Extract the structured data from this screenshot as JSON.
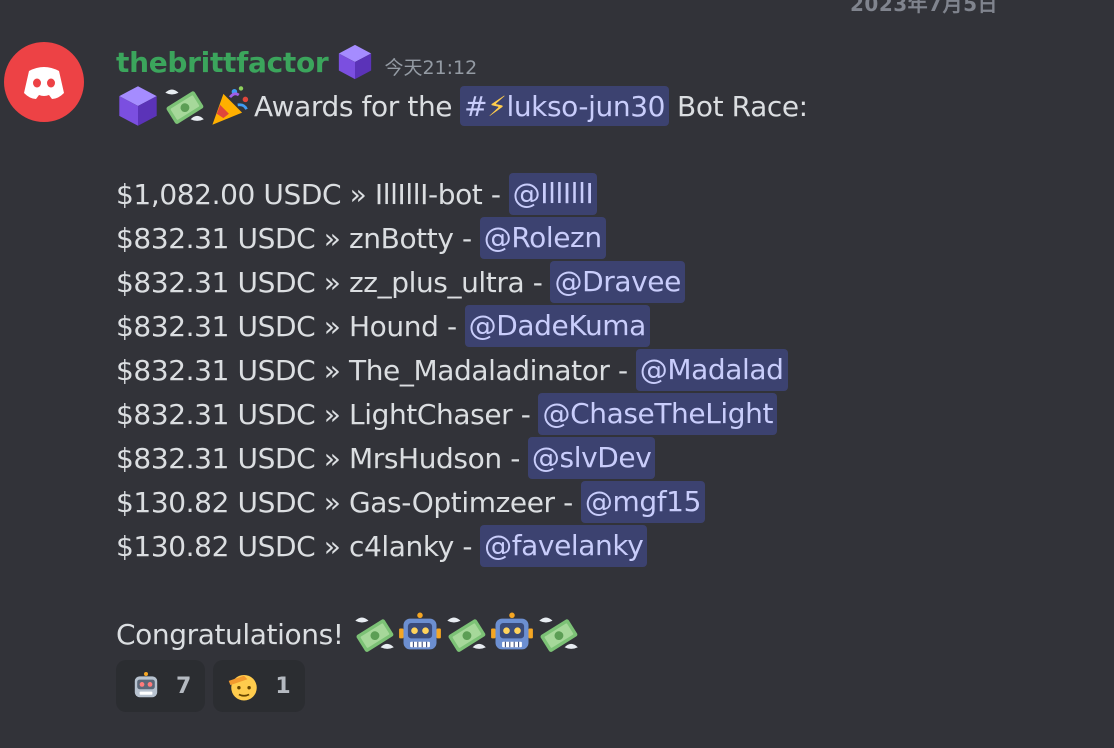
{
  "divider": {
    "date": "2023年7月5日"
  },
  "message": {
    "author": "thebrittfactor",
    "timestamp": "今天21:12",
    "header_text": "Awards for the",
    "channel_hash": "#",
    "channel_bolt": "⚡",
    "channel_name": "lukso-jun30",
    "header_suffix": "Bot Race:",
    "awards": [
      {
        "text": "$1,082.00 USDC » IllIllI-bot -",
        "mention": "@IllIllI"
      },
      {
        "text": "$832.31 USDC » znBotty -",
        "mention": "@Rolezn"
      },
      {
        "text": "$832.31 USDC » zz_plus_ultra -",
        "mention": "@Dravee"
      },
      {
        "text": "$832.31 USDC » Hound -",
        "mention": "@DadeKuma"
      },
      {
        "text": "$832.31 USDC » The_Madaladinator -",
        "mention": "@Madalad"
      },
      {
        "text": "$832.31 USDC » LightChaser -",
        "mention": "@ChaseTheLight"
      },
      {
        "text": "$832.31 USDC » MrsHudson -",
        "mention": "@slvDev"
      },
      {
        "text": "$130.82 USDC » Gas-Optimzeer -",
        "mention": "@mgf15"
      },
      {
        "text": "$130.82 USDC » c4lanky -",
        "mention": "@favelanky"
      }
    ],
    "congrats": "Congratulations!"
  },
  "reactions": [
    {
      "emoji": "robot-icon",
      "count": "7"
    },
    {
      "emoji": "saluting-face-icon",
      "count": "1"
    }
  ],
  "colors": {
    "background": "#323339",
    "username": "#3ba55c",
    "mention_bg": "#3c4270",
    "mention_fg": "#c9cdfb",
    "avatar": "#ed4245"
  }
}
